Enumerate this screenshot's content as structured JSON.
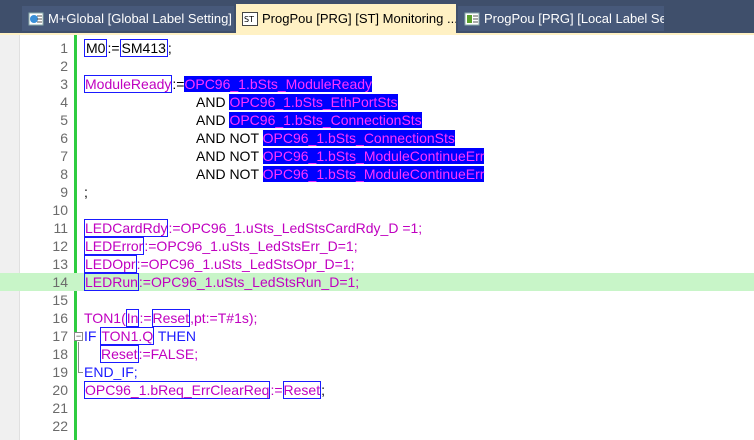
{
  "tabs": [
    {
      "label": "M+Global [Global Label Setting]",
      "icon": "global-label-icon",
      "active": false
    },
    {
      "label": "ProgPou [PRG] [ST] Monitoring ...",
      "icon": "st-program-icon",
      "active": true,
      "close": "×"
    },
    {
      "label": "ProgPou [PRG] [Local Label Sett...",
      "icon": "local-label-icon",
      "active": false
    }
  ],
  "editor": {
    "lines": [
      {
        "num": "1"
      },
      {
        "num": "2"
      },
      {
        "num": "3"
      },
      {
        "num": "4"
      },
      {
        "num": "5"
      },
      {
        "num": "6"
      },
      {
        "num": "7"
      },
      {
        "num": "8"
      },
      {
        "num": "9"
      },
      {
        "num": "10"
      },
      {
        "num": "11"
      },
      {
        "num": "12"
      },
      {
        "num": "13"
      },
      {
        "num": "14"
      },
      {
        "num": "15"
      },
      {
        "num": "16"
      },
      {
        "num": "17"
      },
      {
        "num": "18"
      },
      {
        "num": "19"
      },
      {
        "num": "20"
      },
      {
        "num": "21"
      },
      {
        "num": "22"
      }
    ],
    "code": {
      "l1_a": "M0",
      "l1_b": ":=",
      "l1_c": "SM413",
      "l1_d": ";",
      "l3_a": "ModuleReady",
      "l3_b": ":=",
      "l3_c": "OPC96_1.bSts_ModuleReady",
      "l4_a": "AND ",
      "l4_b": "OPC96_1.bSts_EthPortSts",
      "l5_a": "AND ",
      "l5_b": "OPC96_1.bSts_ConnectionSts",
      "l6_a": "AND NOT ",
      "l6_b": "OPC96_1.bSts_ConnectionSts",
      "l7_a": "AND NOT ",
      "l7_b": "OPC96_1.bSts_ModuleContinueErr",
      "l8_a": "AND NOT ",
      "l8_b": "OPC96_1.bSts_ModuleContinueErr",
      "l9_a": ";",
      "l11_a": "LEDCardRdy",
      "l11_b": ":=OPC96_1.uSts_LedStsCardRdy_D =1;",
      "l12_a": "LEDError",
      "l12_b": ":=OPC96_1.uSts_LedStsErr_D=1;",
      "l13_a": "LEDOpr",
      "l13_b": ":=OPC96_1.uSts_LedStsOpr_D=1;",
      "l14_a": "LEDRun",
      "l14_b": ":=OPC96_1.uSts_LedStsRun_D=1;",
      "l16_a": "TON1(",
      "l16_b": "In",
      "l16_c": ":=",
      "l16_d": "Reset",
      "l16_e": ",pt:=T#1s);",
      "l17_a": "IF ",
      "l17_b": "TON1.Q",
      "l17_c": " THEN",
      "l18_a": "Reset",
      "l18_b": ":=FALSE;",
      "l19_a": "END_IF;",
      "l20_a": "OPC96_1.bReq_ErrClearReq",
      "l20_b": ":=",
      "l20_c": "Reset",
      "l20_d": ";"
    }
  },
  "colors": {
    "tab_bar": "#3f4f6b",
    "active_tab": "#fff1c4",
    "selection_bg": "#0000ff",
    "identifier": "#c000c0",
    "highlight_line": "#c8f5c8",
    "monitor_bar": "#2ecc40"
  }
}
